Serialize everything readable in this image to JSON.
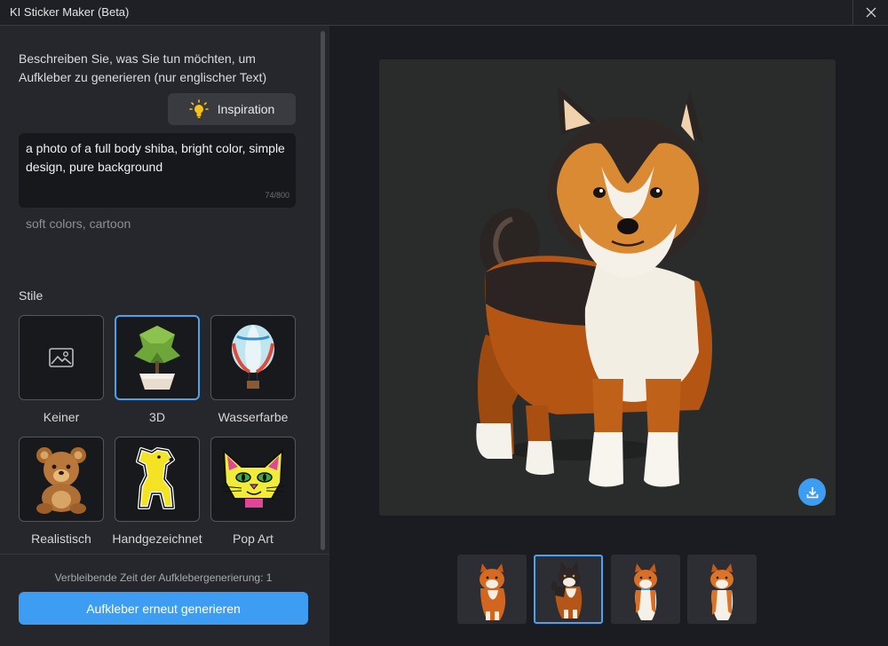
{
  "window": {
    "title": "KI Sticker Maker (Beta)",
    "close_icon": "close-icon"
  },
  "sidebar": {
    "description": "Beschreiben Sie, was Sie tun möchten, um Aufkleber zu generieren (nur englischer Text)",
    "inspiration_label": "Inspiration",
    "prompt": "a photo of a full body shiba, bright color, simple design, pure background",
    "char_count": "74/800",
    "negative_prompt": "soft colors, cartoon",
    "styles_label": "Stile",
    "styles": [
      {
        "label": "Keiner",
        "icon": "image-placeholder-icon",
        "selected": false
      },
      {
        "label": "3D",
        "icon": "low-poly-tree-icon",
        "selected": true
      },
      {
        "label": "Wasserfarbe",
        "icon": "hot-air-balloon-icon",
        "selected": false
      },
      {
        "label": "Realistisch",
        "icon": "teddy-bear-icon",
        "selected": false
      },
      {
        "label": "Handgezeichnet",
        "icon": "dog-sticker-icon",
        "selected": false
      },
      {
        "label": "Pop Art",
        "icon": "pop-art-cat-icon",
        "selected": false
      }
    ],
    "remaining_text": "Verbleibende Zeit der Aufklebergenerierung: 1",
    "regenerate_label": "Aufkleber erneut generieren"
  },
  "preview": {
    "image_icon": "shiba-inu-sticker",
    "download_icon": "download-icon",
    "thumbnails": [
      {
        "icon": "shiba-thumb-orange",
        "selected": false
      },
      {
        "icon": "shiba-thumb-black-tan",
        "selected": true
      },
      {
        "icon": "shiba-thumb-orange-2",
        "selected": false
      },
      {
        "icon": "shiba-thumb-orange-3",
        "selected": false
      }
    ]
  },
  "colors": {
    "accent": "#3d9df2",
    "panel": "#26272c",
    "background": "#1b1c21"
  }
}
